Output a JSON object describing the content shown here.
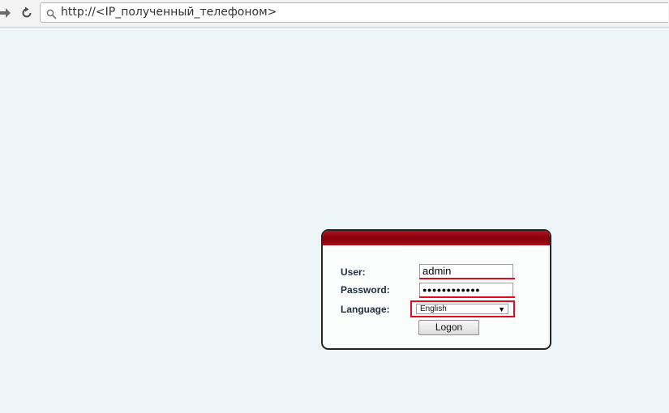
{
  "browser": {
    "url": "http://<IP_полученный_телефоном>",
    "icons": {
      "forward": "forward-arrow-icon",
      "reload": "reload-icon",
      "search": "search-icon"
    }
  },
  "login": {
    "user_label": "User:",
    "user_value": "admin",
    "password_label": "Password:",
    "password_value": "●●●●●●●●●●●●",
    "language_label": "Language:",
    "language_value": "English",
    "logon_label": "Logon",
    "colors": {
      "header": "#9a0714",
      "highlight": "#e2081d"
    }
  }
}
